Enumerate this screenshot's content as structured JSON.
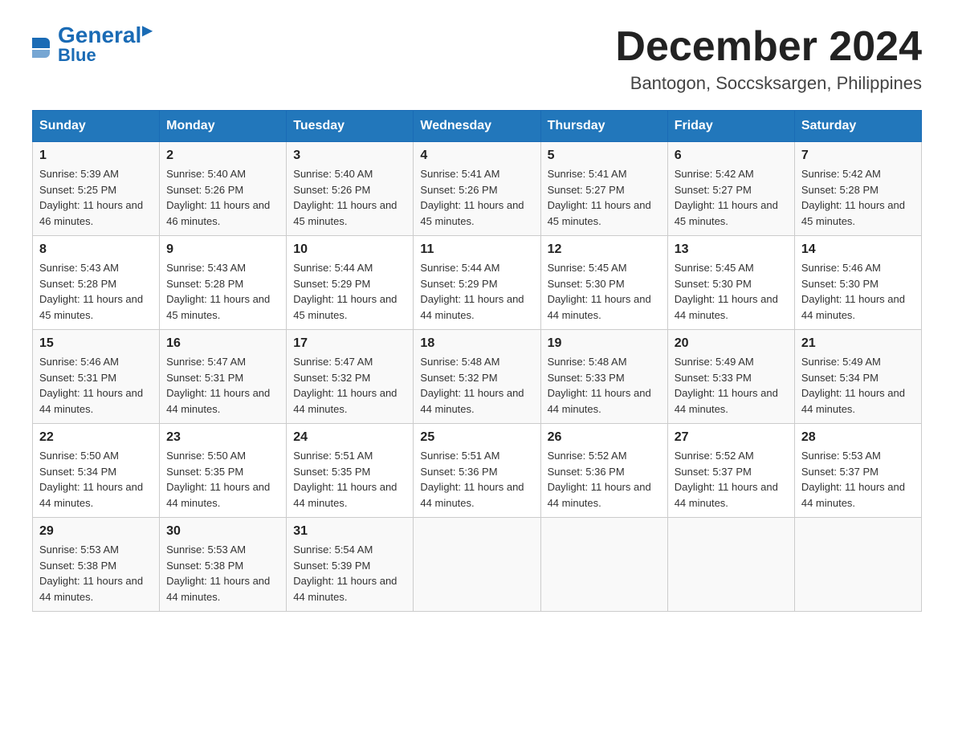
{
  "header": {
    "logo_general": "General",
    "logo_blue": "Blue",
    "month_title": "December 2024",
    "location": "Bantogon, Soccsksargen, Philippines"
  },
  "columns": [
    "Sunday",
    "Monday",
    "Tuesday",
    "Wednesday",
    "Thursday",
    "Friday",
    "Saturday"
  ],
  "weeks": [
    [
      {
        "day": "1",
        "sunrise": "Sunrise: 5:39 AM",
        "sunset": "Sunset: 5:25 PM",
        "daylight": "Daylight: 11 hours and 46 minutes."
      },
      {
        "day": "2",
        "sunrise": "Sunrise: 5:40 AM",
        "sunset": "Sunset: 5:26 PM",
        "daylight": "Daylight: 11 hours and 46 minutes."
      },
      {
        "day": "3",
        "sunrise": "Sunrise: 5:40 AM",
        "sunset": "Sunset: 5:26 PM",
        "daylight": "Daylight: 11 hours and 45 minutes."
      },
      {
        "day": "4",
        "sunrise": "Sunrise: 5:41 AM",
        "sunset": "Sunset: 5:26 PM",
        "daylight": "Daylight: 11 hours and 45 minutes."
      },
      {
        "day": "5",
        "sunrise": "Sunrise: 5:41 AM",
        "sunset": "Sunset: 5:27 PM",
        "daylight": "Daylight: 11 hours and 45 minutes."
      },
      {
        "day": "6",
        "sunrise": "Sunrise: 5:42 AM",
        "sunset": "Sunset: 5:27 PM",
        "daylight": "Daylight: 11 hours and 45 minutes."
      },
      {
        "day": "7",
        "sunrise": "Sunrise: 5:42 AM",
        "sunset": "Sunset: 5:28 PM",
        "daylight": "Daylight: 11 hours and 45 minutes."
      }
    ],
    [
      {
        "day": "8",
        "sunrise": "Sunrise: 5:43 AM",
        "sunset": "Sunset: 5:28 PM",
        "daylight": "Daylight: 11 hours and 45 minutes."
      },
      {
        "day": "9",
        "sunrise": "Sunrise: 5:43 AM",
        "sunset": "Sunset: 5:28 PM",
        "daylight": "Daylight: 11 hours and 45 minutes."
      },
      {
        "day": "10",
        "sunrise": "Sunrise: 5:44 AM",
        "sunset": "Sunset: 5:29 PM",
        "daylight": "Daylight: 11 hours and 45 minutes."
      },
      {
        "day": "11",
        "sunrise": "Sunrise: 5:44 AM",
        "sunset": "Sunset: 5:29 PM",
        "daylight": "Daylight: 11 hours and 44 minutes."
      },
      {
        "day": "12",
        "sunrise": "Sunrise: 5:45 AM",
        "sunset": "Sunset: 5:30 PM",
        "daylight": "Daylight: 11 hours and 44 minutes."
      },
      {
        "day": "13",
        "sunrise": "Sunrise: 5:45 AM",
        "sunset": "Sunset: 5:30 PM",
        "daylight": "Daylight: 11 hours and 44 minutes."
      },
      {
        "day": "14",
        "sunrise": "Sunrise: 5:46 AM",
        "sunset": "Sunset: 5:30 PM",
        "daylight": "Daylight: 11 hours and 44 minutes."
      }
    ],
    [
      {
        "day": "15",
        "sunrise": "Sunrise: 5:46 AM",
        "sunset": "Sunset: 5:31 PM",
        "daylight": "Daylight: 11 hours and 44 minutes."
      },
      {
        "day": "16",
        "sunrise": "Sunrise: 5:47 AM",
        "sunset": "Sunset: 5:31 PM",
        "daylight": "Daylight: 11 hours and 44 minutes."
      },
      {
        "day": "17",
        "sunrise": "Sunrise: 5:47 AM",
        "sunset": "Sunset: 5:32 PM",
        "daylight": "Daylight: 11 hours and 44 minutes."
      },
      {
        "day": "18",
        "sunrise": "Sunrise: 5:48 AM",
        "sunset": "Sunset: 5:32 PM",
        "daylight": "Daylight: 11 hours and 44 minutes."
      },
      {
        "day": "19",
        "sunrise": "Sunrise: 5:48 AM",
        "sunset": "Sunset: 5:33 PM",
        "daylight": "Daylight: 11 hours and 44 minutes."
      },
      {
        "day": "20",
        "sunrise": "Sunrise: 5:49 AM",
        "sunset": "Sunset: 5:33 PM",
        "daylight": "Daylight: 11 hours and 44 minutes."
      },
      {
        "day": "21",
        "sunrise": "Sunrise: 5:49 AM",
        "sunset": "Sunset: 5:34 PM",
        "daylight": "Daylight: 11 hours and 44 minutes."
      }
    ],
    [
      {
        "day": "22",
        "sunrise": "Sunrise: 5:50 AM",
        "sunset": "Sunset: 5:34 PM",
        "daylight": "Daylight: 11 hours and 44 minutes."
      },
      {
        "day": "23",
        "sunrise": "Sunrise: 5:50 AM",
        "sunset": "Sunset: 5:35 PM",
        "daylight": "Daylight: 11 hours and 44 minutes."
      },
      {
        "day": "24",
        "sunrise": "Sunrise: 5:51 AM",
        "sunset": "Sunset: 5:35 PM",
        "daylight": "Daylight: 11 hours and 44 minutes."
      },
      {
        "day": "25",
        "sunrise": "Sunrise: 5:51 AM",
        "sunset": "Sunset: 5:36 PM",
        "daylight": "Daylight: 11 hours and 44 minutes."
      },
      {
        "day": "26",
        "sunrise": "Sunrise: 5:52 AM",
        "sunset": "Sunset: 5:36 PM",
        "daylight": "Daylight: 11 hours and 44 minutes."
      },
      {
        "day": "27",
        "sunrise": "Sunrise: 5:52 AM",
        "sunset": "Sunset: 5:37 PM",
        "daylight": "Daylight: 11 hours and 44 minutes."
      },
      {
        "day": "28",
        "sunrise": "Sunrise: 5:53 AM",
        "sunset": "Sunset: 5:37 PM",
        "daylight": "Daylight: 11 hours and 44 minutes."
      }
    ],
    [
      {
        "day": "29",
        "sunrise": "Sunrise: 5:53 AM",
        "sunset": "Sunset: 5:38 PM",
        "daylight": "Daylight: 11 hours and 44 minutes."
      },
      {
        "day": "30",
        "sunrise": "Sunrise: 5:53 AM",
        "sunset": "Sunset: 5:38 PM",
        "daylight": "Daylight: 11 hours and 44 minutes."
      },
      {
        "day": "31",
        "sunrise": "Sunrise: 5:54 AM",
        "sunset": "Sunset: 5:39 PM",
        "daylight": "Daylight: 11 hours and 44 minutes."
      },
      {
        "day": "",
        "sunrise": "",
        "sunset": "",
        "daylight": ""
      },
      {
        "day": "",
        "sunrise": "",
        "sunset": "",
        "daylight": ""
      },
      {
        "day": "",
        "sunrise": "",
        "sunset": "",
        "daylight": ""
      },
      {
        "day": "",
        "sunrise": "",
        "sunset": "",
        "daylight": ""
      }
    ]
  ]
}
